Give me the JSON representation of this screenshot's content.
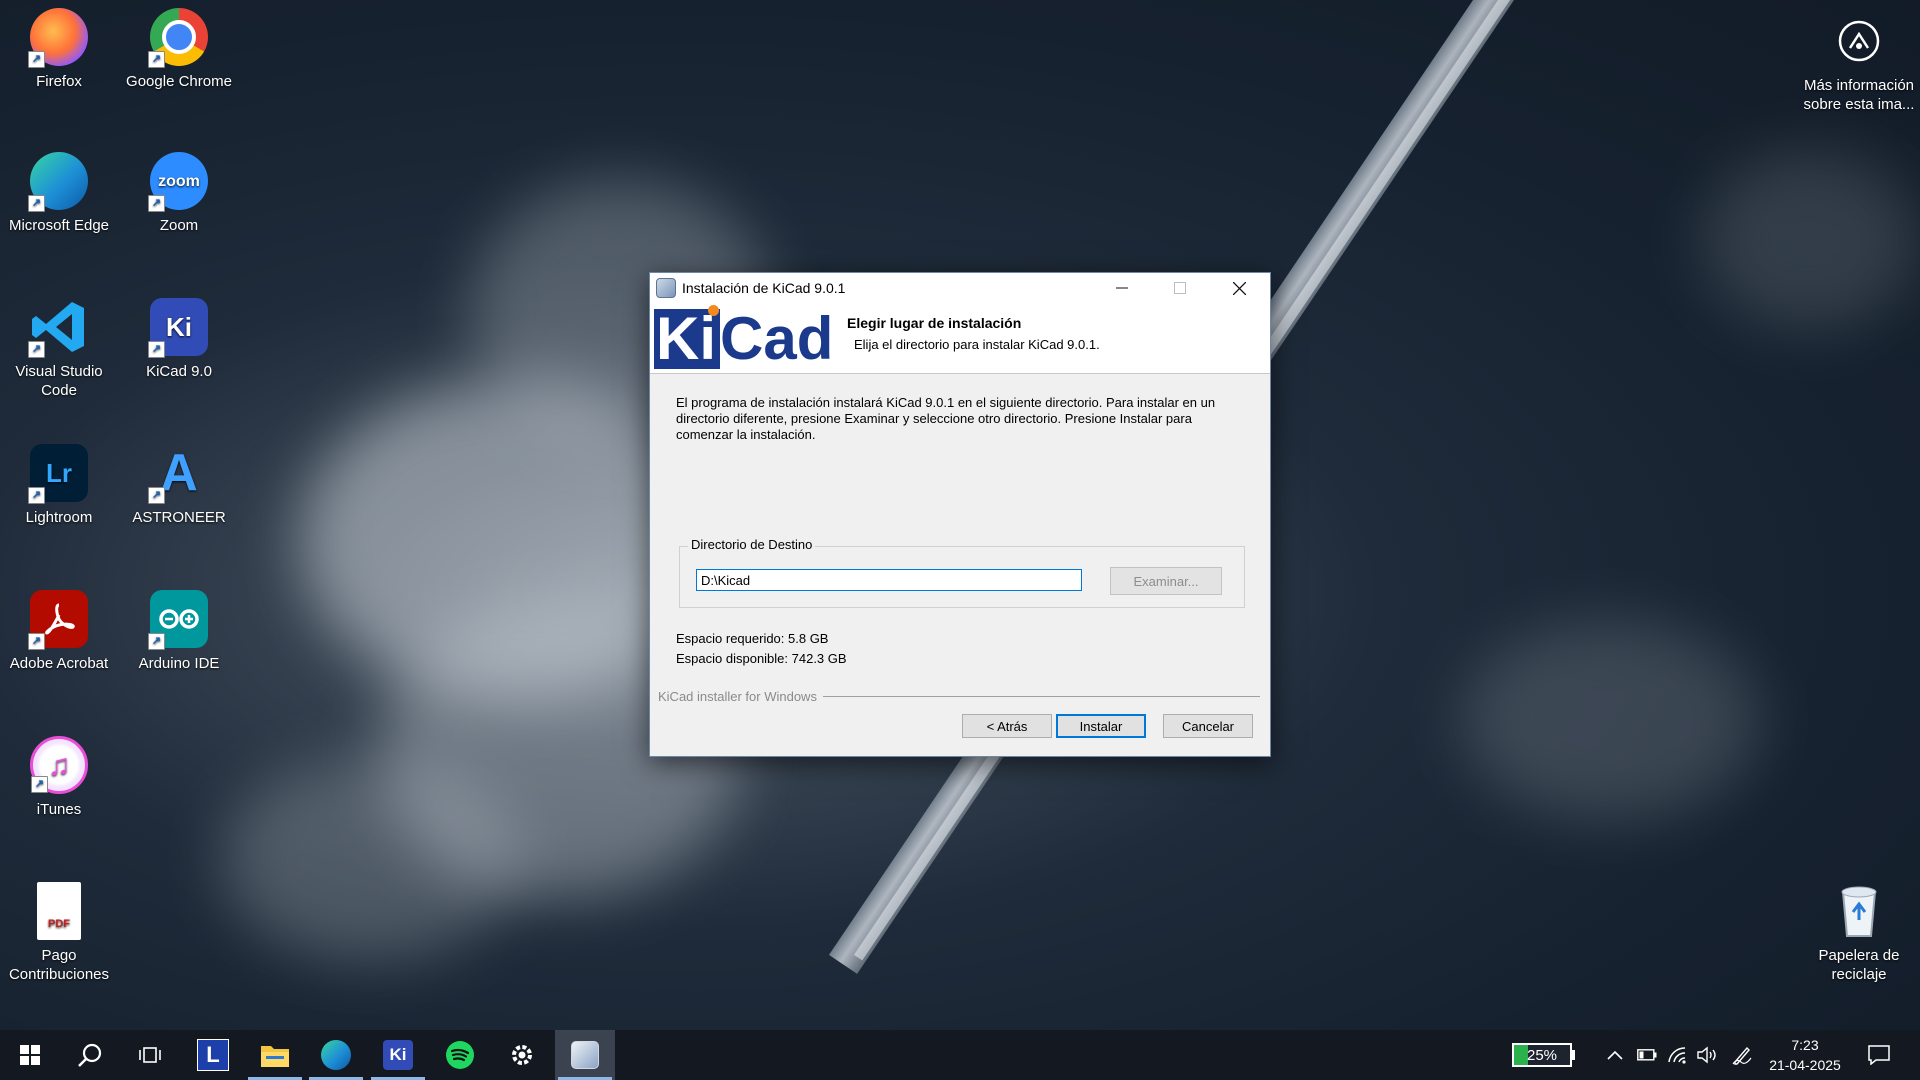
{
  "desktop": {
    "icons": [
      {
        "label": "Firefox"
      },
      {
        "label": "Google Chrome"
      },
      {
        "label": "Microsoft Edge"
      },
      {
        "label": "Zoom",
        "glyph": "zoom"
      },
      {
        "label": "Visual Studio Code"
      },
      {
        "label": "KiCad 9.0",
        "glyph": "Ki"
      },
      {
        "label": "Lightroom",
        "glyph": "Lr"
      },
      {
        "label": "ASTRONEER",
        "glyph": "A"
      },
      {
        "label": "Adobe Acrobat"
      },
      {
        "label": "Arduino IDE"
      },
      {
        "label": "iTunes"
      },
      {
        "label": "Pago Contribuciones",
        "glyph": "PDF"
      },
      {
        "label": "Más información sobre esta ima..."
      },
      {
        "label": "Papelera de reciclaje"
      }
    ]
  },
  "dialog": {
    "title": "Instalación de KiCad 9.0.1",
    "logo": {
      "part1": "Ki",
      "part2": "Cad"
    },
    "header_title": "Elegir lugar de instalación",
    "header_subtitle": "Elija el directorio para instalar KiCad 9.0.1.",
    "intro": "El programa de instalación instalará KiCad 9.0.1 en el siguiente directorio. Para instalar en un directorio diferente, presione Examinar y seleccione otro directorio. Presione Instalar para comenzar la instalación.",
    "group_label": "Directorio de Destino",
    "path_value": "D:\\Kicad",
    "browse_label": "Examinar...",
    "space_required": "Espacio requerido: 5.8 GB",
    "space_available": "Espacio disponible: 742.3 GB",
    "brand": "KiCad installer for Windows",
    "back_label": "< Atrás",
    "install_label": "Instalar",
    "cancel_label": "Cancelar"
  },
  "taskbar": {
    "battery": "25%",
    "time": "7:23",
    "date": "21-04-2025",
    "apps": [
      {
        "name": "L"
      },
      {
        "name": "Ki"
      }
    ]
  },
  "colors": {
    "accent": "#0078d7",
    "kicad_blue": "#1b3a8c",
    "kicad_orange": "#f28a1f",
    "battery_green": "#2bb24c"
  }
}
